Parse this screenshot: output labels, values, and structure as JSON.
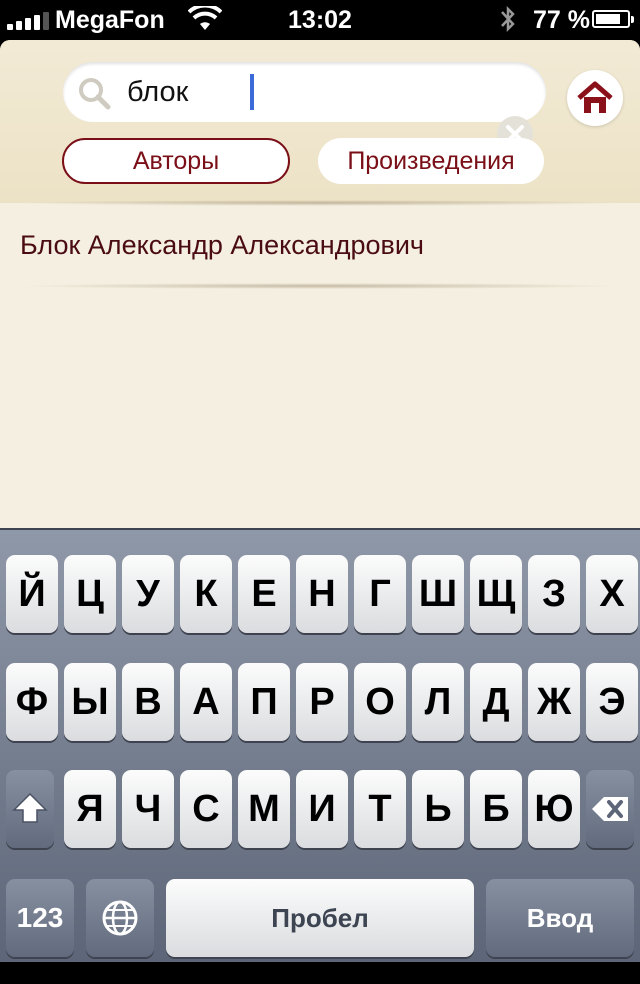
{
  "status_bar": {
    "carrier": "MegaFon",
    "time": "13:02",
    "battery_percent": "77 %",
    "signal_icon": "signal-bars-icon",
    "wifi_icon": "wifi-icon",
    "bluetooth_icon": "bluetooth-icon",
    "battery_icon": "battery-icon"
  },
  "search": {
    "value": "блок",
    "search_icon": "search-icon",
    "clear_icon": "clear-icon"
  },
  "home_icon": "home-icon",
  "tabs": [
    {
      "label": "Авторы",
      "selected": true
    },
    {
      "label": "Произведения",
      "selected": false
    }
  ],
  "results": [
    {
      "label": "Блок Александр Александрович"
    }
  ],
  "keyboard": {
    "rows": [
      [
        "Й",
        "Ц",
        "У",
        "К",
        "Е",
        "Н",
        "Г",
        "Ш",
        "Щ",
        "З",
        "Х"
      ],
      [
        "Ф",
        "Ы",
        "В",
        "А",
        "П",
        "Р",
        "О",
        "Л",
        "Д",
        "Ж",
        "Э"
      ],
      [
        "Я",
        "Ч",
        "С",
        "М",
        "И",
        "Т",
        "Ь",
        "Б",
        "Ю"
      ]
    ],
    "numbers_label": "123",
    "space_label": "Пробел",
    "return_label": "Ввод",
    "shift_icon": "shift-icon",
    "backspace_icon": "backspace-icon",
    "globe_icon": "globe-icon"
  },
  "colors": {
    "accent": "#7a0f17",
    "background": "#f4efe0"
  }
}
